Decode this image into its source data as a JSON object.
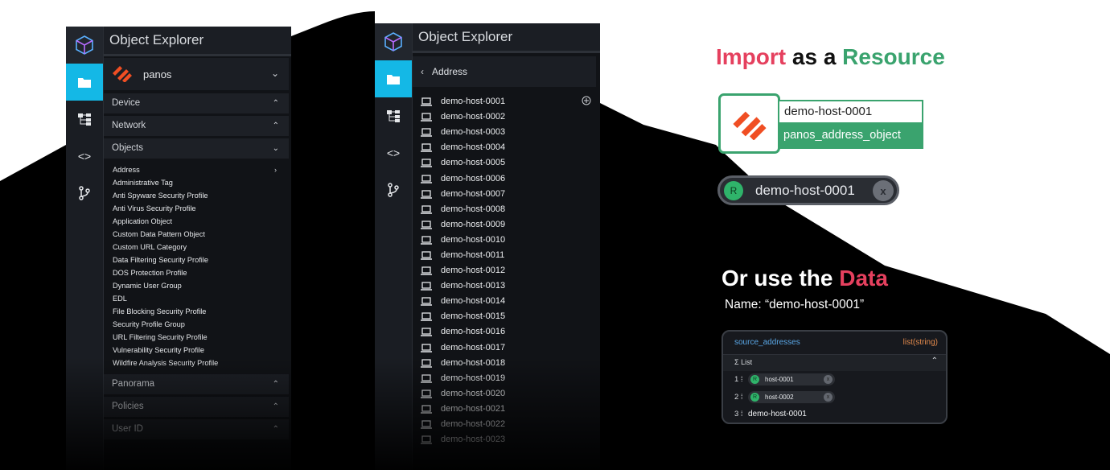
{
  "left_panel": {
    "title": "Object Explorer",
    "provider": "panos",
    "sections": [
      "Device",
      "Network",
      "Objects"
    ],
    "object_items": [
      "Address",
      "Administrative Tag",
      "Anti Spyware Security Profile",
      "Anti Virus Security Profile",
      "Application Object",
      "Custom Data Pattern Object",
      "Custom URL Category",
      "Data Filtering Security Profile",
      "DOS Protection Profile",
      "Dynamic User Group",
      "EDL",
      "File Blocking Security Profile",
      "Security Profile Group",
      "URL Filtering Security Profile",
      "Vulnerability Security Profile",
      "Wildfire Analysis Security Profile"
    ],
    "bottom_sections": [
      "Panorama",
      "Policies",
      "User ID"
    ],
    "rail_icons": [
      "cube-logo-icon",
      "folder-icon",
      "hierarchy-icon",
      "code-icon",
      "branch-icon"
    ]
  },
  "middle_panel": {
    "title": "Object Explorer",
    "breadcrumb": "Address",
    "hosts": [
      "demo-host-0001",
      "demo-host-0002",
      "demo-host-0003",
      "demo-host-0004",
      "demo-host-0005",
      "demo-host-0006",
      "demo-host-0007",
      "demo-host-0008",
      "demo-host-0009",
      "demo-host-0010",
      "demo-host-0011",
      "demo-host-0012",
      "demo-host-0013",
      "demo-host-0014",
      "demo-host-0015",
      "demo-host-0016",
      "demo-host-0017",
      "demo-host-0018",
      "demo-host-0019",
      "demo-host-0020",
      "demo-host-0021",
      "demo-host-0022",
      "demo-host-0023"
    ]
  },
  "import": {
    "w1": "Import",
    "w2": "as a",
    "w3": "Resource",
    "resource_name": "demo-host-0001",
    "resource_type": "panos_address_object",
    "chip_letter": "R",
    "chip_label": "demo-host-0001",
    "chip_close": "x"
  },
  "data": {
    "w1": "Or use the",
    "w2": "Data",
    "name_line": "Name: “demo-host-0001”",
    "field": "source_addresses",
    "field_type": "list(string)",
    "list_label": "Σ List",
    "entries": [
      {
        "index": "1 ⁞",
        "letter": "R",
        "value": "host-0001"
      },
      {
        "index": "2 ⁞",
        "letter": "R",
        "value": "host-0002"
      }
    ],
    "last_index": "3 ⁞",
    "last_value": "demo-host-0001"
  },
  "colors": {
    "accent_blue": "#14b8e6",
    "brand_red": "#e5405e",
    "brand_green": "#3aa36e",
    "panel_bg": "#111317",
    "shape": "#000000"
  }
}
